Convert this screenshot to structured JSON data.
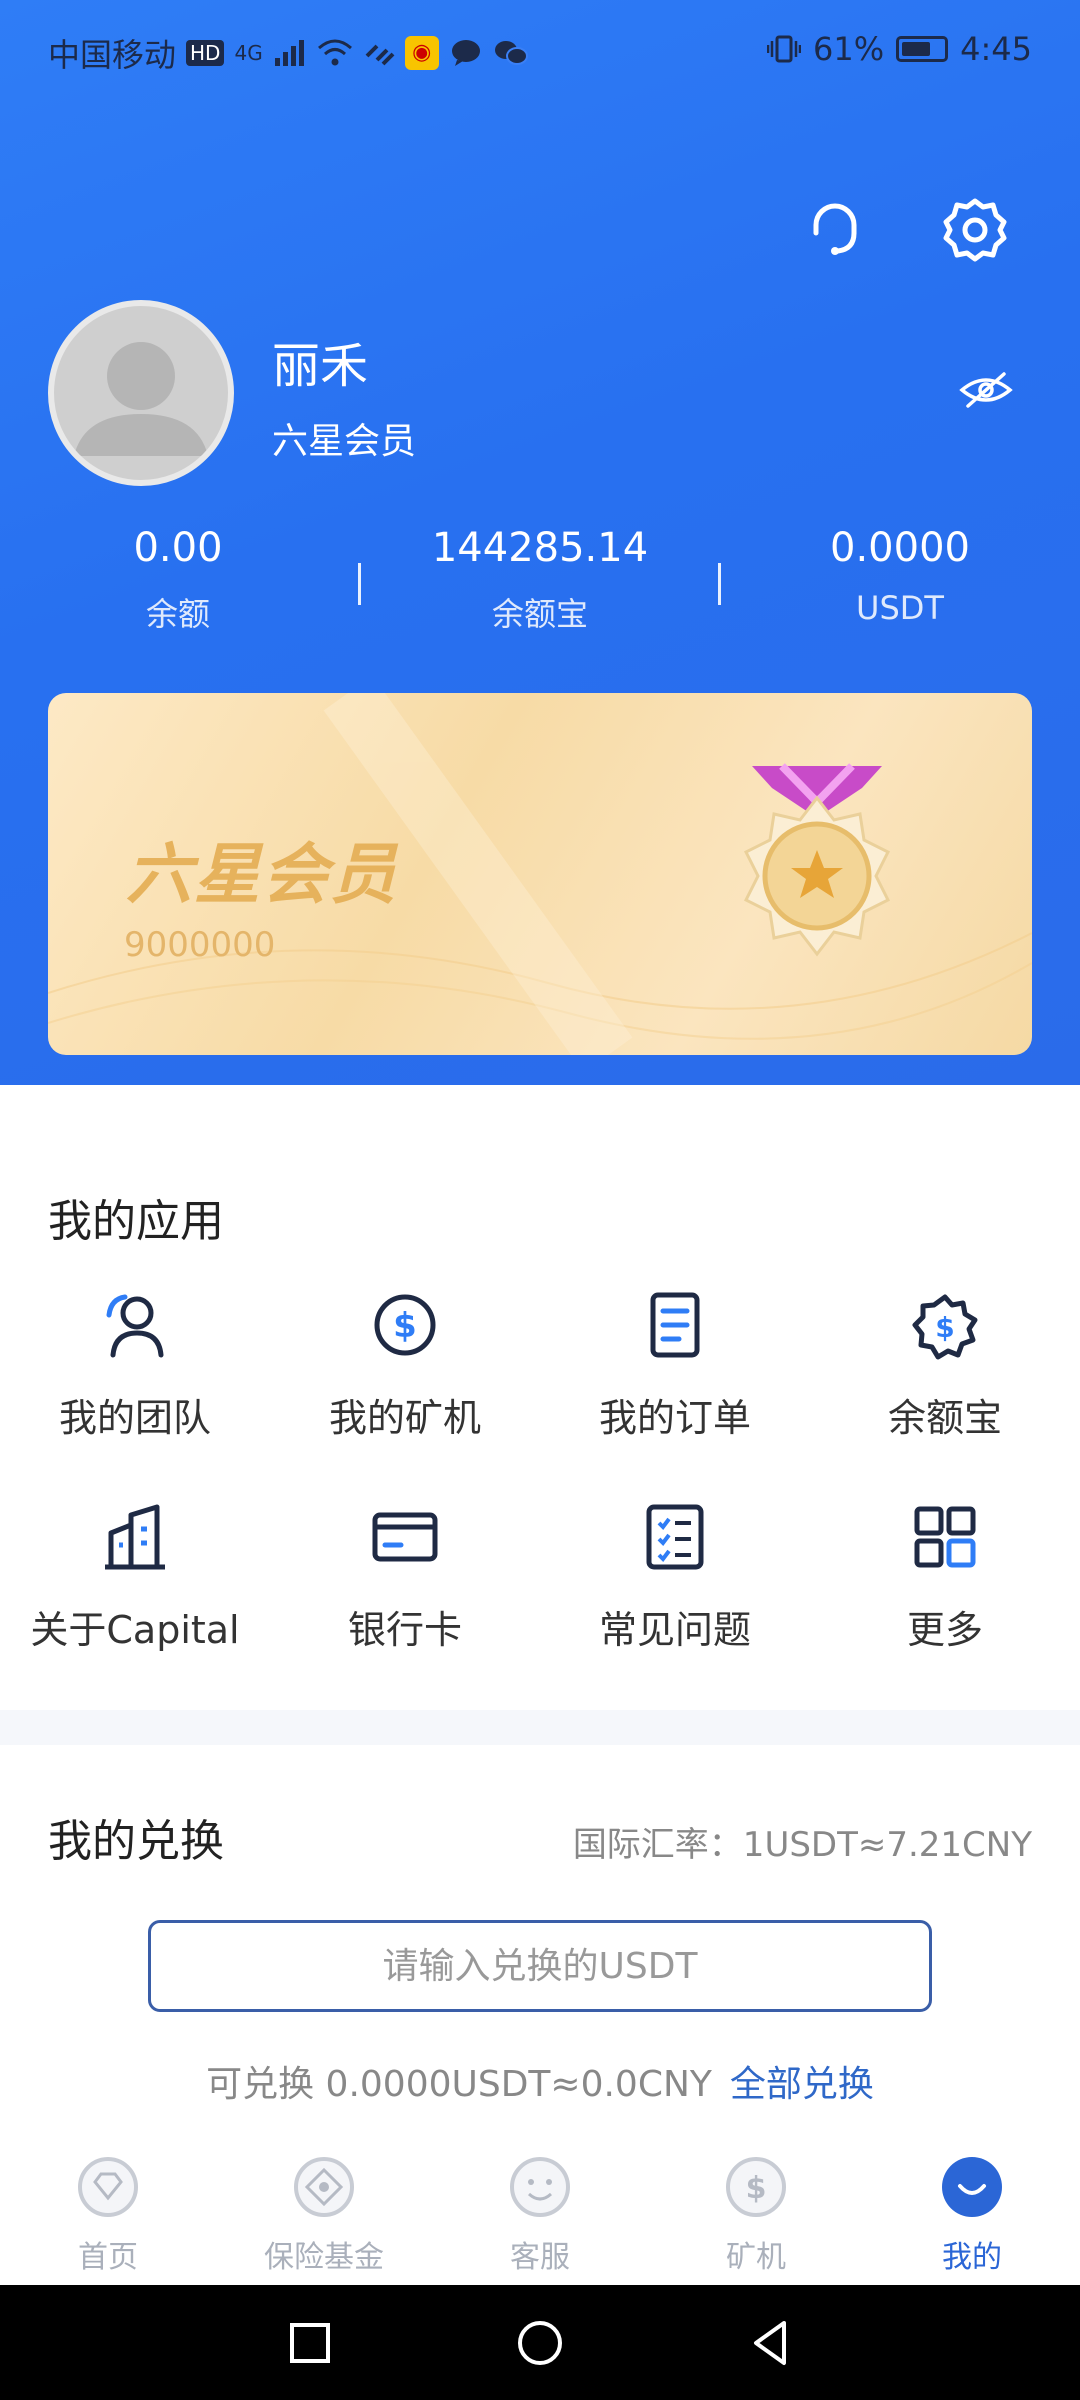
{
  "status_bar": {
    "carrier": "中国移动",
    "hd": "HD",
    "network": "4G",
    "battery": "61%",
    "time": "4:45"
  },
  "header": {
    "support_icon": "headset-icon",
    "settings_icon": "gear-icon"
  },
  "user": {
    "name": "丽禾",
    "level": "六星会员"
  },
  "stats": [
    {
      "value": "0.00",
      "label": "余额"
    },
    {
      "value": "144285.14",
      "label": "余额宝"
    },
    {
      "value": "0.0000",
      "label": "USDT"
    }
  ],
  "member_card": {
    "title": "六星会员",
    "number": "9000000"
  },
  "apps": {
    "title": "我的应用",
    "items": [
      {
        "label": "我的团队",
        "icon": "team-icon"
      },
      {
        "label": "我的矿机",
        "icon": "miner-icon"
      },
      {
        "label": "我的订单",
        "icon": "order-icon"
      },
      {
        "label": "余额宝",
        "icon": "piggy-bank-icon"
      },
      {
        "label": "关于Capital",
        "icon": "building-icon"
      },
      {
        "label": "银行卡",
        "icon": "bank-card-icon"
      },
      {
        "label": "常见问题",
        "icon": "faq-icon"
      },
      {
        "label": "更多",
        "icon": "grid-icon"
      }
    ]
  },
  "exchange": {
    "title": "我的兑换",
    "rate": "国际汇率：1USDT≈7.21CNY",
    "placeholder": "请输入兑换的USDT",
    "available": "可兑换 0.0000USDT≈0.0CNY",
    "exchange_all": "全部兑换"
  },
  "bottom_nav": [
    {
      "label": "首页",
      "icon": "home-icon",
      "active": false
    },
    {
      "label": "保险基金",
      "icon": "fund-icon",
      "active": false
    },
    {
      "label": "客服",
      "icon": "service-icon",
      "active": false
    },
    {
      "label": "矿机",
      "icon": "miner-icon",
      "active": false
    },
    {
      "label": "我的",
      "icon": "profile-icon",
      "active": true
    }
  ],
  "colors": {
    "primary": "#2f7df6",
    "active_nav": "#2b66d6",
    "card_gold": "#e6b25c"
  }
}
